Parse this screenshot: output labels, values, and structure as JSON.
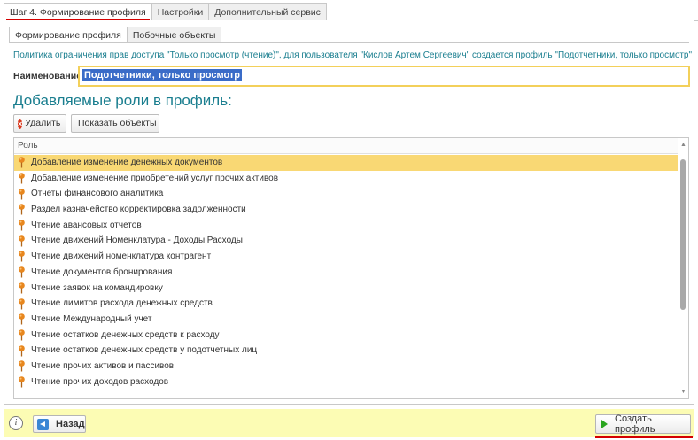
{
  "top_tabs": [
    {
      "label": "Шаг 4. Формирование профиля",
      "active": true
    },
    {
      "label": "Настройки",
      "active": false
    },
    {
      "label": "Дополнительный сервис",
      "active": false
    }
  ],
  "sub_tabs": [
    {
      "label": "Формирование профиля",
      "active": true
    },
    {
      "label": "Побочные объекты",
      "active": false
    }
  ],
  "info_text": "Политика ограничения прав доступа \"Только просмотр (чтение)\", для пользователя \"Кислов Артем Сергеевич\" создается профиль \"Подотчетники, только просмотр\"",
  "name_field": {
    "label": "Наименование:",
    "value": "Подотчетники, только просмотр"
  },
  "section_title": "Добавляемые роли в профиль:",
  "toolbar": {
    "delete_label": "Удалить",
    "show_label": "Показать объекты"
  },
  "table": {
    "column": "Роль",
    "rows": [
      "Добавление изменение денежных документов",
      "Добавление изменение приобретений услуг прочих активов",
      "Отчеты финансового аналитика",
      "Раздел казначейство корректировка задолженности",
      "Чтение авансовых отчетов",
      "Чтение движений Номенклатура - Доходы|Расходы",
      "Чтение движений номенклатура контрагент",
      "Чтение документов бронирования",
      "Чтение заявок на командировку",
      "Чтение лимитов расхода денежных средств",
      "Чтение Международный учет",
      "Чтение остатков денежных средств к расходу",
      "Чтение остатков денежных средств у подотчетных лиц",
      "Чтение прочих активов и пассивов",
      "Чтение прочих доходов расходов"
    ],
    "selected_index": 0
  },
  "footer": {
    "info_label": "i",
    "back_label": "Назад",
    "create_label": "Создать профиль"
  },
  "colors": {
    "accent_teal": "#1a7e8f",
    "selection": "#f9d874",
    "footer_bg": "#fcfcb4",
    "marker_red": "#d40000"
  }
}
